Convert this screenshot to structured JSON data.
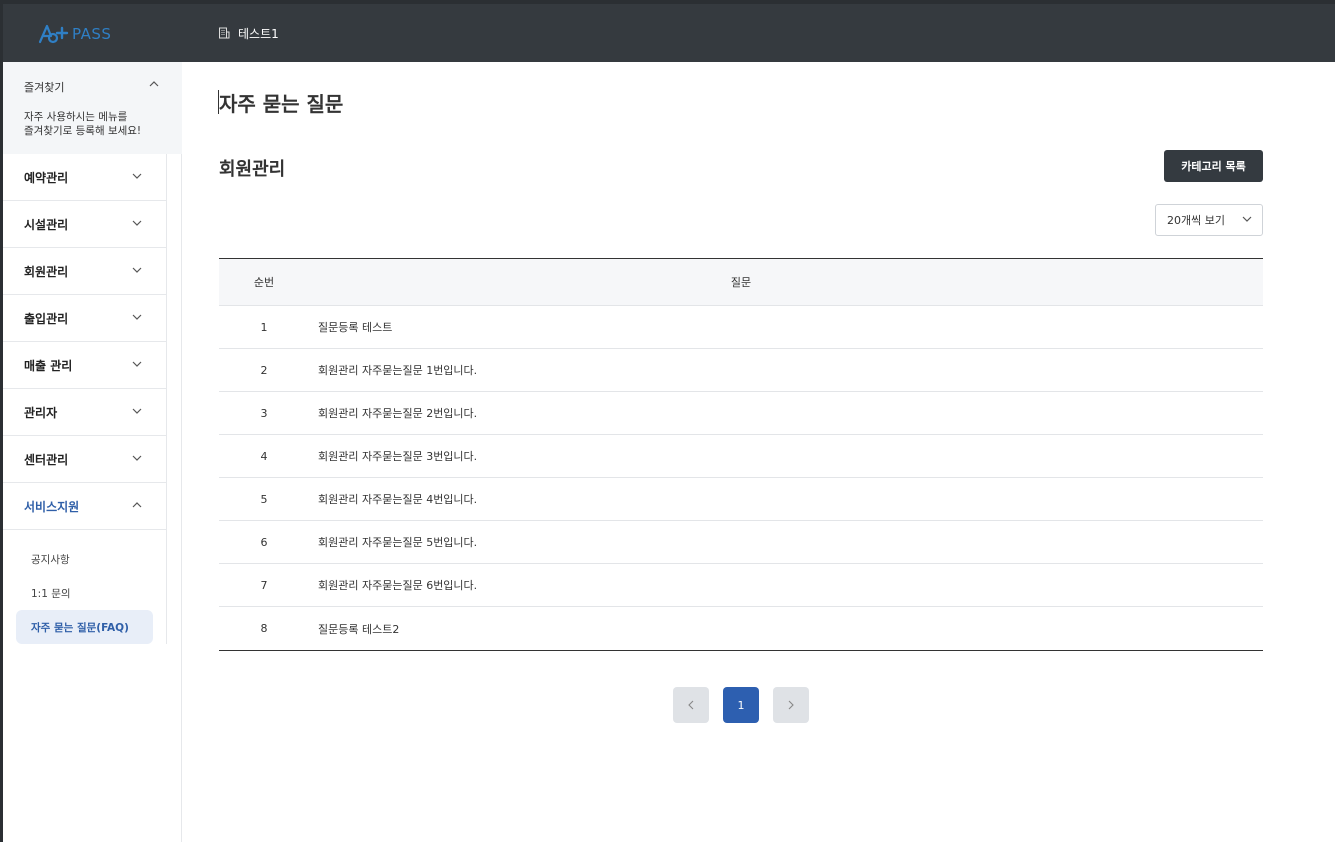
{
  "header": {
    "logo_text": "PASS",
    "center_name": "테스트1"
  },
  "sidebar": {
    "favorites": {
      "title": "즐겨찾기",
      "description": "자주 사용하시는 메뉴를\n즐겨찾기로 등록해 보세요!"
    },
    "items": [
      {
        "label": "예약관리"
      },
      {
        "label": "시설관리"
      },
      {
        "label": "회원관리"
      },
      {
        "label": "출입관리"
      },
      {
        "label": "매출 관리"
      },
      {
        "label": "관리자"
      },
      {
        "label": "센터관리"
      },
      {
        "label": "서비스지원"
      }
    ],
    "sub_items": [
      {
        "label": "공지사항"
      },
      {
        "label": "1:1 문의"
      },
      {
        "label": "자주 묻는 질문(FAQ)"
      }
    ]
  },
  "main": {
    "page_title": "자주 묻는 질문",
    "section_title": "회원관리",
    "category_button": "카테고리 목록",
    "per_page": "20개씩 보기",
    "table": {
      "headers": {
        "no": "순번",
        "question": "질문"
      },
      "rows": [
        {
          "no": "1",
          "question": "질문등록 테스트"
        },
        {
          "no": "2",
          "question": "회원관리 자주묻는질문 1번입니다."
        },
        {
          "no": "3",
          "question": "회원관리 자주묻는질문 2번입니다."
        },
        {
          "no": "4",
          "question": "회원관리 자주묻는질문 3번입니다."
        },
        {
          "no": "5",
          "question": "회원관리 자주묻는질문 4번입니다."
        },
        {
          "no": "6",
          "question": "회원관리 자주묻는질문 5번입니다."
        },
        {
          "no": "7",
          "question": "회원관리 자주묻는질문 6번입니다."
        },
        {
          "no": "8",
          "question": "질문등록 테스트2"
        }
      ]
    },
    "pagination": {
      "current": "1",
      "prev_icon": "chevron-left-icon",
      "next_icon": "chevron-right-icon"
    }
  },
  "colors": {
    "header_bg": "#353a3f",
    "accent": "#2d5fb0",
    "dark_button": "#343a40"
  }
}
